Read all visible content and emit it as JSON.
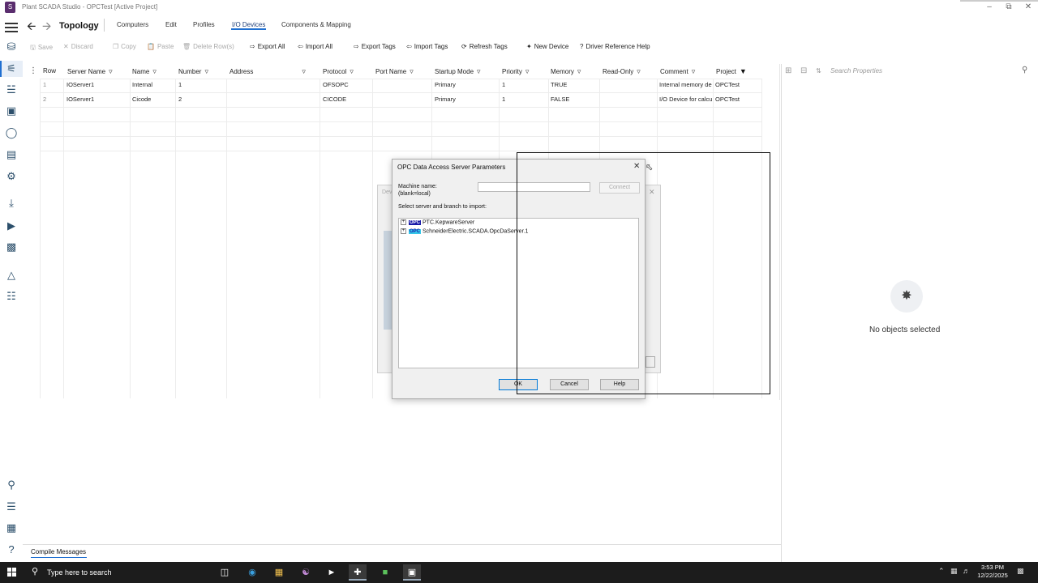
{
  "window": {
    "title": "Plant SCADA Studio - OPCTest [Active Project]",
    "logo_letter": "S"
  },
  "nav": {
    "page_title": "Topology",
    "tabs": [
      "Computers",
      "Edit",
      "Profiles",
      "I/O Devices",
      "Components & Mapping"
    ],
    "active_tab": "I/O Devices"
  },
  "toolbar": {
    "save": "Save",
    "discard": "Discard",
    "copy": "Copy",
    "paste": "Paste",
    "delete_rows": "Delete Row(s)",
    "export_all": "Export All",
    "import_all": "Import All",
    "export_tags": "Export Tags",
    "import_tags": "Import Tags",
    "refresh_tags": "Refresh Tags",
    "new_device": "New Device",
    "driver_help": "Driver Reference Help"
  },
  "grid": {
    "columns": [
      "Row",
      "Server Name",
      "Name",
      "Number",
      "Address",
      "Protocol",
      "Port Name",
      "Startup Mode",
      "Priority",
      "Memory",
      "Read-Only",
      "Comment",
      "Project"
    ],
    "rows": [
      [
        "1",
        "IOServer1",
        "Internal",
        "1",
        "",
        "OFSOPC",
        "",
        "Primary",
        "1",
        "TRUE",
        "",
        "Internal memory de",
        "OPCTest"
      ],
      [
        "2",
        "IOServer1",
        "Cicode",
        "2",
        "",
        "CICODE",
        "",
        "Primary",
        "1",
        "FALSE",
        "",
        "I/O Device for calcu",
        "OPCTest"
      ]
    ]
  },
  "properties": {
    "search_placeholder": "Search Properties",
    "empty_text": "No objects selected"
  },
  "background_dialog": {
    "title_fragment": "Dev"
  },
  "dialog": {
    "title": "OPC Data Access Server Parameters",
    "machine_label_1": "Machine name:",
    "machine_label_2": "(blank=local)",
    "machine_value": "",
    "connect": "Connect",
    "select_label": "Select server and branch to import:",
    "servers": [
      "PTC.KepwareServer",
      "SchneiderElectric.SCADA.OpcDaServer.1"
    ],
    "opc_badge": "OPC",
    "ok": "OK",
    "cancel": "Cancel",
    "help": "Help"
  },
  "bottom": {
    "compile_messages": "Compile Messages"
  },
  "taskbar": {
    "search_text": "Type here to search",
    "time": "3:53 PM",
    "date": "12/22/2025"
  }
}
